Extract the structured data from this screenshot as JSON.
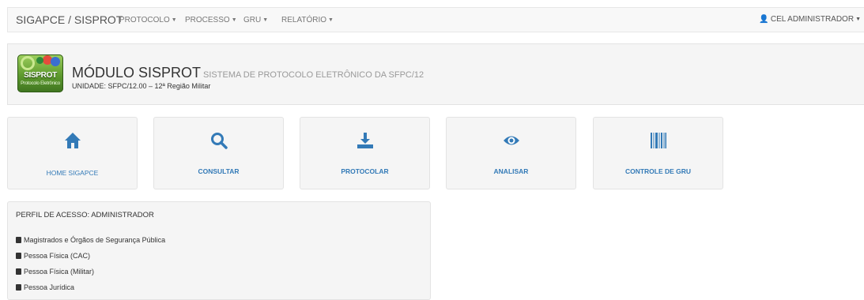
{
  "navbar": {
    "brand": "SIGAPCE / SISPROT",
    "menus": [
      {
        "label": "PROTOCOLO"
      },
      {
        "label": "PROCESSO"
      },
      {
        "label": "GRU"
      },
      {
        "label": "RELATÓRIO"
      }
    ],
    "user": {
      "label": "CEL ADMINISTRADOR",
      "icon": "user-icon"
    }
  },
  "header": {
    "logo": {
      "title": "SISPROT",
      "subtitle": "Protocolo Eletrônico"
    },
    "module_title": "MÓDULO SISPROT",
    "module_subtitle": "SISTEMA DE PROTOCOLO ELETRÔNICO DA SFPC/12",
    "unit": "UNIDADE: SFPC/12.00 – 12ª Região Militar"
  },
  "tiles": [
    {
      "label": "HOME SIGAPCE",
      "icon": "home-icon"
    },
    {
      "label": "CONSULTAR",
      "icon": "search-icon"
    },
    {
      "label": "PROTOCOLAR",
      "icon": "download-icon"
    },
    {
      "label": "ANALISAR",
      "icon": "eye-icon"
    },
    {
      "label": "CONTROLE DE GRU",
      "icon": "barcode-icon"
    }
  ],
  "profile": {
    "title": "PERFIL DE ACESSO: ADMINISTRADOR",
    "items": [
      "Magistrados e Órgãos de Segurança Pública",
      "Pessoa Física (CAC)",
      "Pessoa Física (Militar)",
      "Pessoa Jurídica"
    ]
  },
  "colors": {
    "accent": "#337ab7",
    "panel": "#f5f5f5",
    "navbar": "#f8f8f8",
    "logo_green": "#5e9a2e"
  }
}
